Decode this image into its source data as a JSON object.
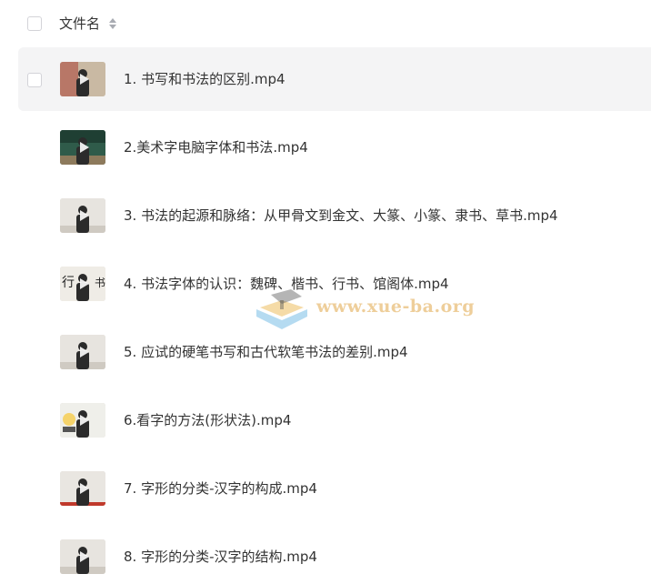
{
  "header": {
    "select_all_label": "",
    "column_label": "文件名",
    "sort_icon": "sort-icon"
  },
  "files": [
    {
      "name": "1. 书写和书法的区别.mp4",
      "thumb": "lecture-blackboard"
    },
    {
      "name": "2.美术字电脑字体和书法.mp4",
      "thumb": "lecture-greenboard"
    },
    {
      "name": "3. 书法的起源和脉络：从甲骨文到金文、大篆、小篆、隶书、草书.mp4",
      "thumb": "lecture-white"
    },
    {
      "name": "4. 书法字体的认识：魏碑、楷书、行书、馆阁体.mp4",
      "thumb": "lecture-calligraphy"
    },
    {
      "name": "5. 应试的硬笔书写和古代软笔书法的差别.mp4",
      "thumb": "lecture-white"
    },
    {
      "name": "6.看字的方法(形状法).mp4",
      "thumb": "lecture-shapes"
    },
    {
      "name": "7. 字形的分类-汉字的构成.mp4",
      "thumb": "lecture-red"
    },
    {
      "name": "8. 字形的分类-汉字的结构.mp4",
      "thumb": "lecture-white"
    }
  ],
  "watermark": {
    "text": "www.xue-ba.org"
  },
  "colors": {
    "hover_row": "#f4f4f5",
    "text": "#333333",
    "checkbox_border": "#d3d3d8",
    "watermark": "#e8be78"
  }
}
